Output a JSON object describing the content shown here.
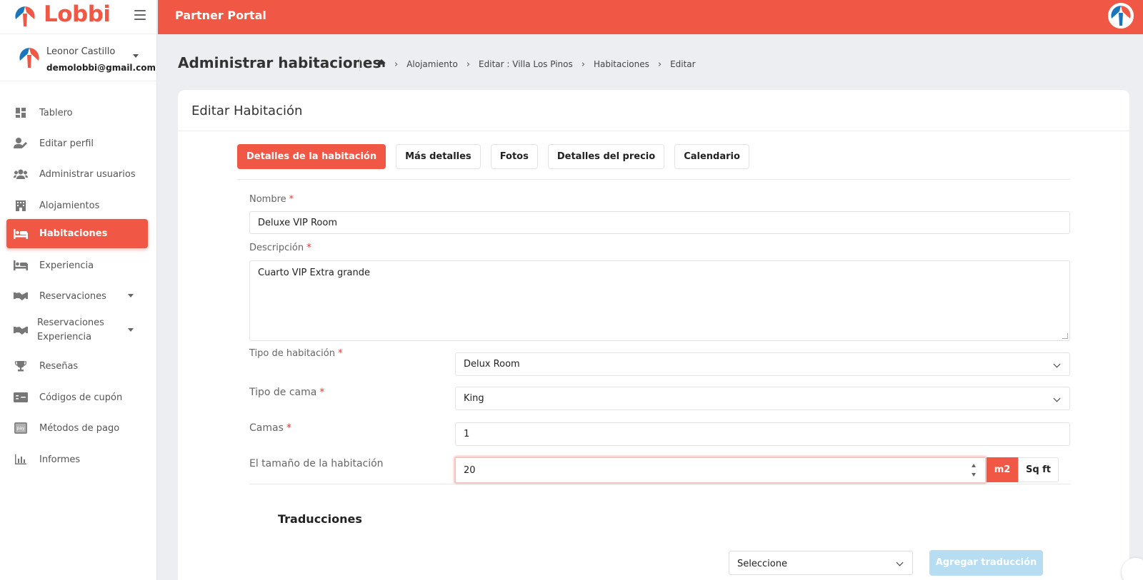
{
  "brand": {
    "name": "Lobbi",
    "portal_title": "Partner Portal"
  },
  "user": {
    "name": "Leonor Castillo",
    "email": "demolobbi@gmail.com"
  },
  "sidebar": {
    "items": [
      {
        "label": "Tablero",
        "icon": "dashboard-icon"
      },
      {
        "label": "Editar perfil",
        "icon": "user-edit-icon"
      },
      {
        "label": "Administrar usuarios",
        "icon": "users-icon"
      },
      {
        "label": "Alojamientos",
        "icon": "building-icon"
      },
      {
        "label": "Habitaciones",
        "icon": "bed-icon",
        "active": true
      },
      {
        "label": "Experiencia",
        "icon": "bed-icon"
      },
      {
        "label": "Reservaciones",
        "icon": "handshake-icon",
        "has_caret": true
      },
      {
        "label": "Reservaciones Experiencia",
        "icon": "handshake-icon",
        "has_caret": true
      },
      {
        "label": "Reseñas",
        "icon": "trophy-icon"
      },
      {
        "label": "Códigos de cupón",
        "icon": "coupon-icon"
      },
      {
        "label": "Métodos de pago",
        "icon": "payment-icon"
      },
      {
        "label": "Informes",
        "icon": "chart-icon"
      }
    ]
  },
  "page": {
    "title": "Administrar habitaciones",
    "breadcrumb": [
      "Alojamiento",
      "Editar : Villa Los Pinos",
      "Habitaciones",
      "Editar"
    ]
  },
  "card": {
    "title": "Editar Habitación",
    "tabs": [
      "Detalles de la habitación",
      "Más detalles",
      "Fotos",
      "Detalles del precio",
      "Calendario"
    ],
    "active_tab": 0
  },
  "form": {
    "name_label": "Nombre",
    "name_value": "Deluxe VIP Room",
    "description_label": "Descripción",
    "description_value": "Cuarto VIP Extra grande",
    "room_type_label": "Tipo de habitación",
    "room_type_value": "Delux Room",
    "bed_type_label": "Tipo de cama",
    "bed_type_value": "King",
    "beds_label": "Camas",
    "beds_value": "1",
    "size_label": "El tamaño de la habitación",
    "size_value": "20",
    "unit_m2": "m2",
    "unit_sqft": "Sq ft",
    "required_mark": "*"
  },
  "translations": {
    "heading": "Traducciones",
    "select_placeholder": "Seleccione",
    "add_button": "Agregar traducción"
  },
  "colors": {
    "accent": "#f15745",
    "disabled_button": "#b7ddf3"
  }
}
